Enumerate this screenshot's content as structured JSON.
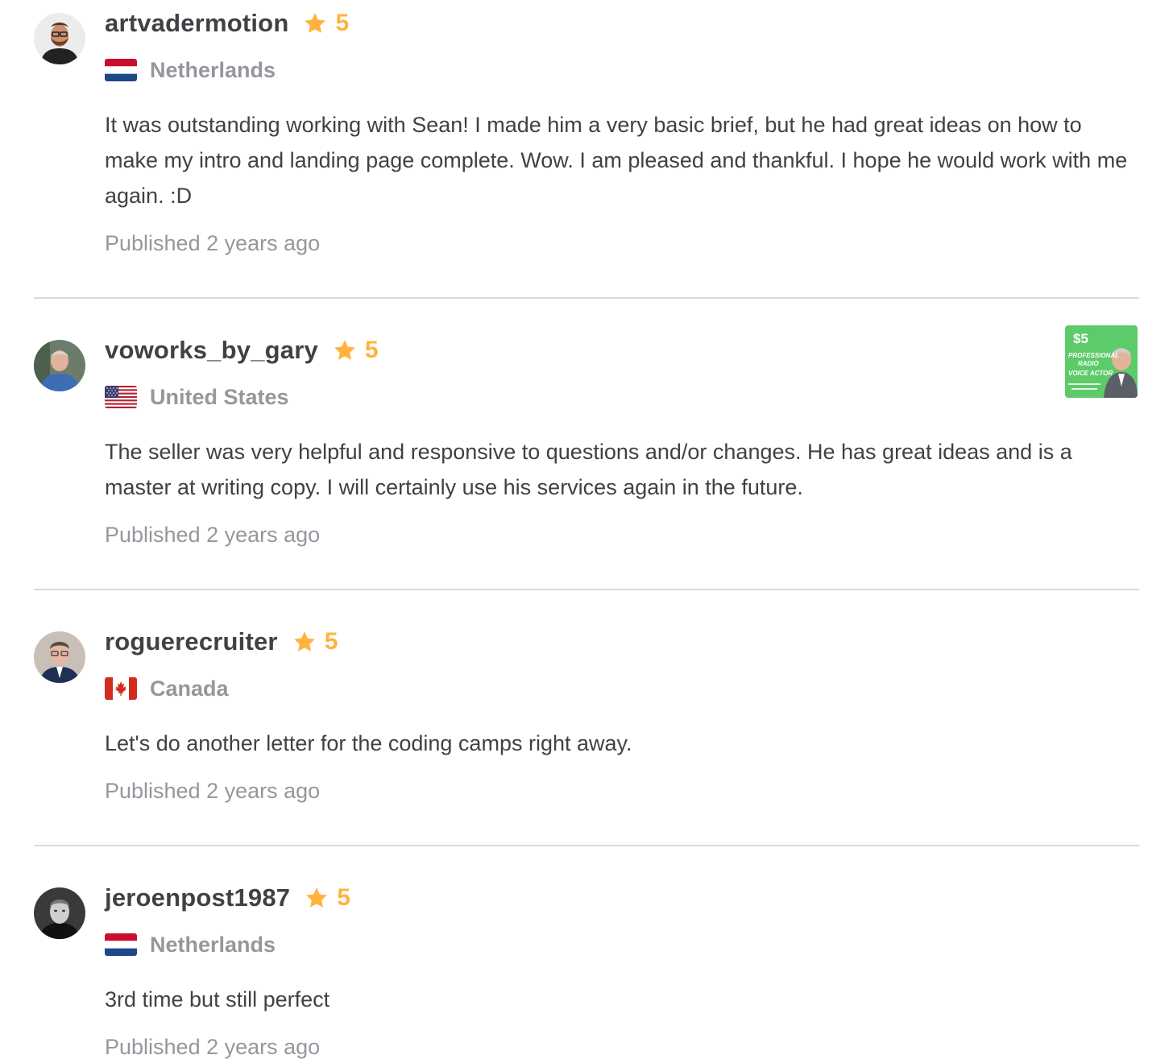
{
  "reviews": [
    {
      "username": "artvadermotion",
      "rating": "5",
      "country": "Netherlands",
      "flag": "netherlands-flag",
      "text": "It was outstanding working with Sean! I made him a very basic brief, but he had great ideas on how to make my intro and landing page complete. Wow. I am pleased and thankful. I hope he would work with me again. :D",
      "published": "Published 2 years ago"
    },
    {
      "username": "voworks_by_gary",
      "rating": "5",
      "country": "United States",
      "flag": "united-states-flag",
      "text": "The seller was very helpful and responsive to questions and/or changes. He has great ideas and is a master at writing copy. I will certainly use his services again in the future.",
      "published": "Published 2 years ago",
      "thumbnail": {
        "price": "$5",
        "line1": "PROFESSIONAL",
        "line2": "RADIO",
        "line3": "VOICE ACTOR",
        "bg_color": "#5ecb6b"
      }
    },
    {
      "username": "roguerecruiter",
      "rating": "5",
      "country": "Canada",
      "flag": "canada-flag",
      "text": "Let's do another letter for the coding camps right away.",
      "published": "Published 2 years ago"
    },
    {
      "username": "jeroenpost1987",
      "rating": "5",
      "country": "Netherlands",
      "flag": "netherlands-flag",
      "text": "3rd time but still perfect",
      "published": "Published 2 years ago"
    }
  ],
  "colors": {
    "star": "#ffb33e",
    "text": "#404145",
    "muted": "#95979d",
    "divider": "#dadbdd"
  }
}
